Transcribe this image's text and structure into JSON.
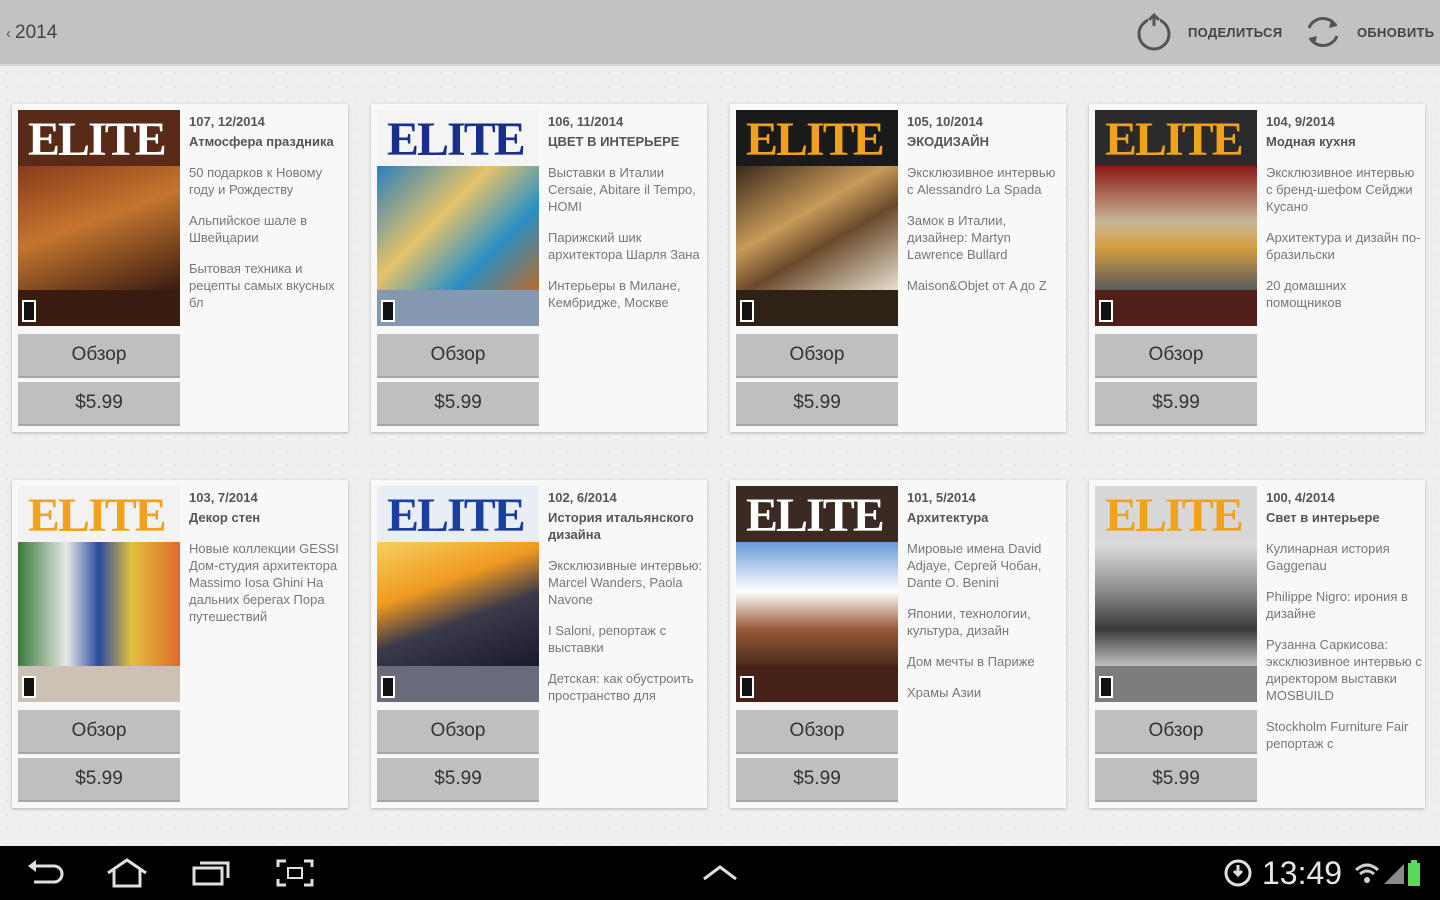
{
  "header": {
    "back_label": "2014",
    "share_label": "ПОДЕЛИТЬСЯ",
    "refresh_label": "ОБНОВИТЬ",
    "share_icon": "share-icon",
    "refresh_icon": "refresh-icon"
  },
  "colors": {
    "topbar": "#c2c2c2",
    "button": "#bfbfbf",
    "card": "#f8f8f8",
    "navbar": "#000000"
  },
  "issues": [
    {
      "cover_title": "ELITE",
      "issue_label": "107, 12/2014",
      "headline": "Атмосфера праздника",
      "descriptions": [
        "50 подарков к Новому году и Рождеству",
        "Альпийское шале в Швейцарии",
        "Бытовая техника и рецепты самых вкусных бл"
      ],
      "view_label": "Обзор",
      "price": "$5.99"
    },
    {
      "cover_title": "ELITE",
      "issue_label": "106, 11/2014",
      "headline": "ЦВЕТ В ИНТЕРЬЕРЕ",
      "descriptions": [
        "Выставки в Италии Cersaie, Abitare il Tempo, HOMI",
        "Парижский шик архитектора Шарля Зана",
        "Интерьеры в Милане, Кембридже, Москве"
      ],
      "view_label": "Обзор",
      "price": "$5.99"
    },
    {
      "cover_title": "ELITE",
      "issue_label": "105, 10/2014",
      "headline": "ЭКОДИЗАЙН",
      "descriptions": [
        "Эксклюзивное интервью с Alessandro La Spada",
        "Замок в Италии, дизайнер: Martyn Lawrence Bullard",
        "Maison&Objet от A до Z"
      ],
      "view_label": "Обзор",
      "price": "$5.99"
    },
    {
      "cover_title": "ELITE",
      "issue_label": "104, 9/2014",
      "headline": "Модная кухня",
      "descriptions": [
        "Эксклюзивное интервью с бренд-шефом Сейджи Кусано",
        "Архитектура и дизайн по-бразильски",
        "20 домашних помощников"
      ],
      "view_label": "Обзор",
      "price": "$5.99"
    },
    {
      "cover_title": "ELITE",
      "issue_label": "103, 7/2014",
      "headline": "Декор стен",
      "descriptions": [
        "Новые коллекции GESSI Дом-студия архитектора Massimo Iosa Ghini На дальних берегах Пора путешествий"
      ],
      "view_label": "Обзор",
      "price": "$5.99"
    },
    {
      "cover_title": "ELITE",
      "issue_label": "102, 6/2014",
      "headline": "История итальянского дизайна",
      "descriptions": [
        "Эксклюзивные интервью: Marcel Wanders, Paola Navone",
        "I Saloni, репортаж с выставки",
        "Детская: как обустроить пространство для"
      ],
      "view_label": "Обзор",
      "price": "$5.99"
    },
    {
      "cover_title": "ELITE",
      "issue_label": "101, 5/2014",
      "headline": "Архитектура",
      "descriptions": [
        "Мировые имена David Adjaye, Сергей Чобан, Dante O. Benini",
        "Японии, технологии, культура, дизайн",
        "Дом мечты в Париже",
        "Храмы Азии"
      ],
      "view_label": "Обзор",
      "price": "$5.99"
    },
    {
      "cover_title": "ELITE",
      "issue_label": "100, 4/2014",
      "headline": "Свет в интерьере",
      "descriptions": [
        "Кулинарная история Gaggenau",
        "Philippe Nigro: ирония в дизайне",
        "Рузанна Саркисова: эксклюзивное интервью с директором выставки MOSBUILD",
        "Stockholm Furniture Fair репортаж с"
      ],
      "view_label": "Обзор",
      "price": "$5.99"
    }
  ],
  "system_bar": {
    "time": "13:49"
  }
}
